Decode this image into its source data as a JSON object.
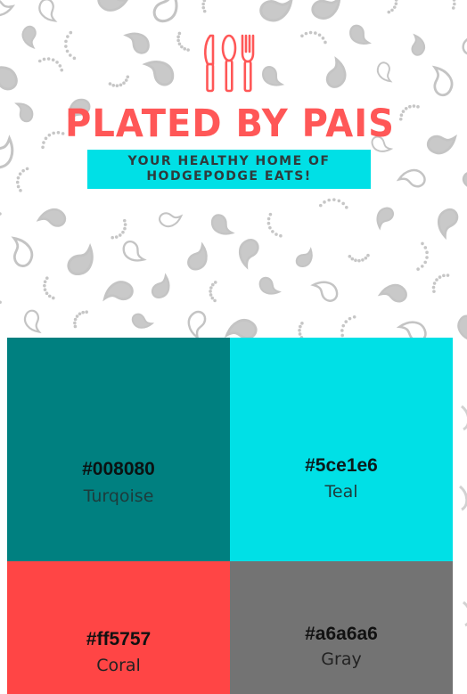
{
  "header": {
    "brand": "PLATED BY PAIS",
    "tagline": "YOUR HEALTHY HOME OF HODGEPODGE EATS!",
    "logo_icon": "knife-spoon-fork-icon",
    "brand_color": "#ff5757",
    "tagline_bg": "#00e0e6"
  },
  "palette": [
    {
      "hex": "#008080",
      "name": "Turqoise",
      "color": "#008080"
    },
    {
      "hex": "#5ce1e6",
      "name": "Teal",
      "color": "#00e0e6"
    },
    {
      "hex": "#ff5757",
      "name": "Coral",
      "color": "#ff4545"
    },
    {
      "hex": "#a6a6a6",
      "name": "Gray",
      "color": "#737373"
    }
  ],
  "background_pattern": "gray-paisley-dots"
}
